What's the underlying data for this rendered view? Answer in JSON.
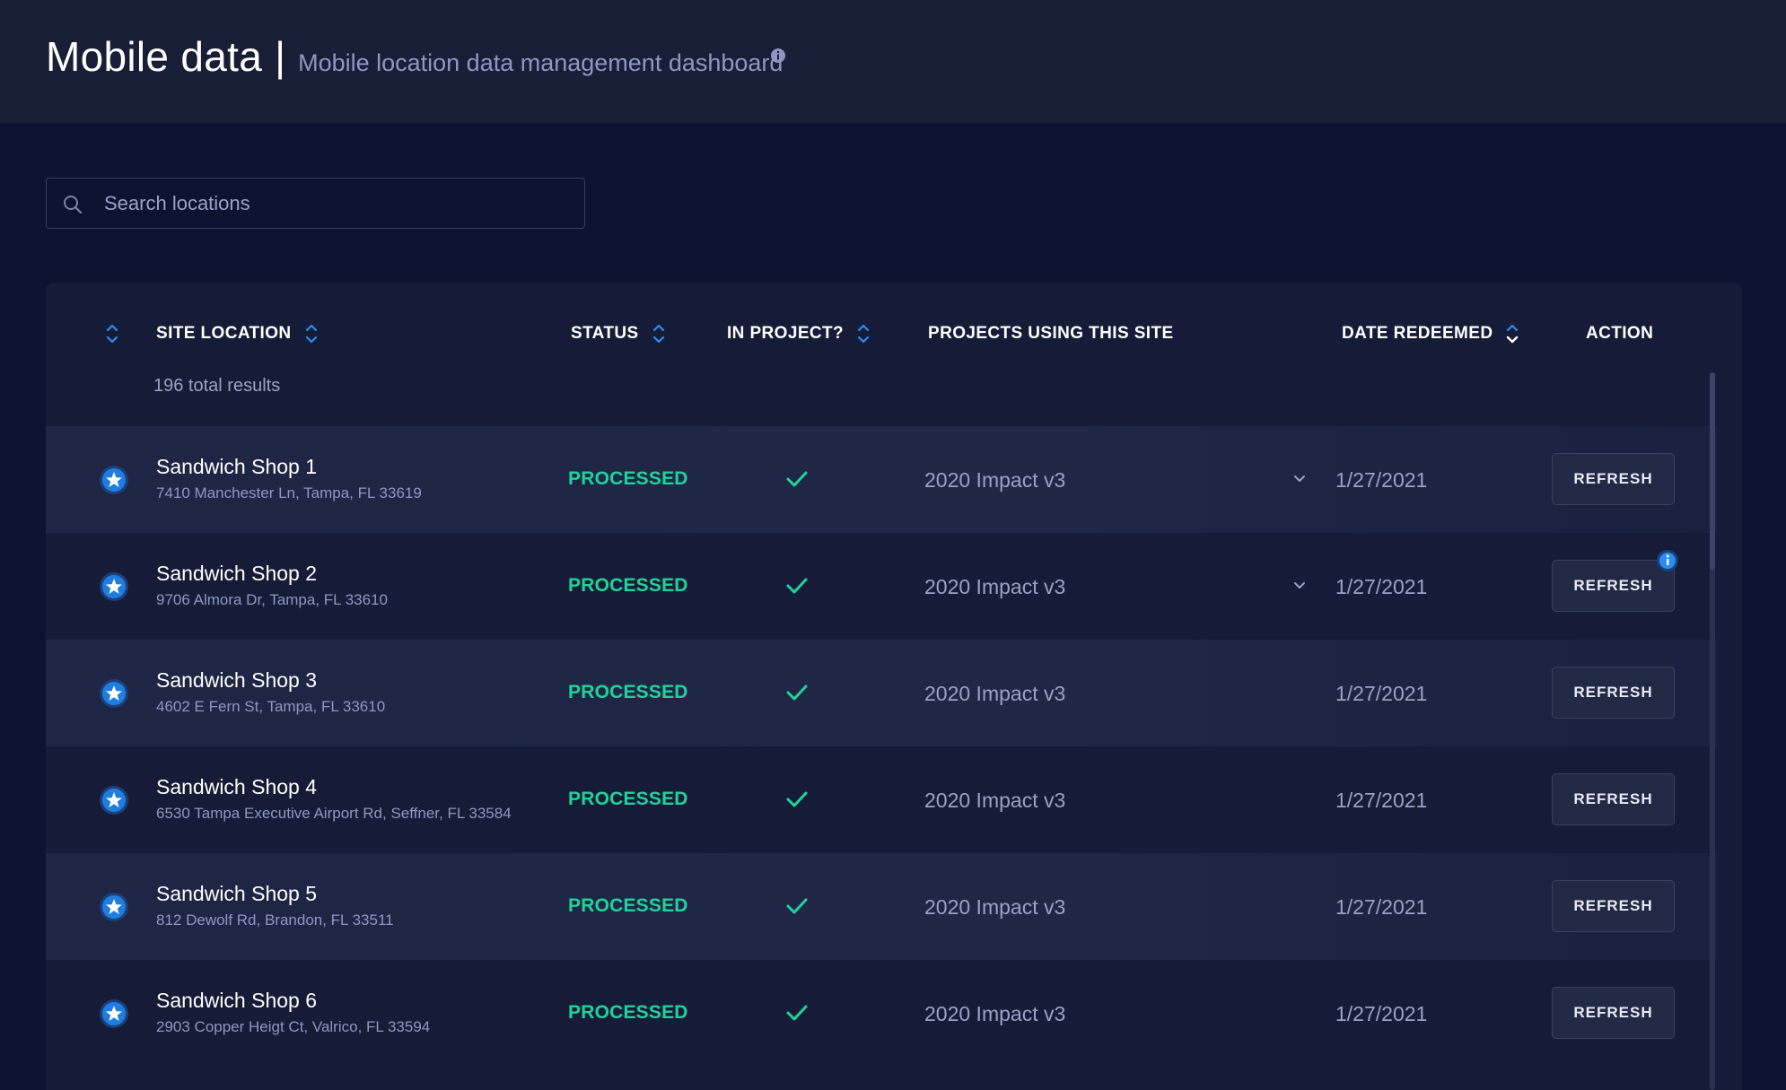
{
  "header": {
    "title": "Mobile data",
    "separator": "|",
    "subtitle": "Mobile location data management dashboard",
    "info_icon": "info-circle-icon"
  },
  "search": {
    "placeholder": "Search locations",
    "value": "",
    "icon": "search-icon"
  },
  "table": {
    "columns": [
      {
        "key": "favorite",
        "label": "",
        "sortable": true
      },
      {
        "key": "site_location",
        "label": "SITE LOCATION",
        "sortable": true
      },
      {
        "key": "status",
        "label": "STATUS",
        "sortable": true
      },
      {
        "key": "in_project",
        "label": "IN PROJECT?",
        "sortable": true
      },
      {
        "key": "projects",
        "label": "PROJECTS USING THIS SITE",
        "sortable": false
      },
      {
        "key": "date_redeemed",
        "label": "DATE REDEEMED",
        "sortable": true,
        "sort_active": "descending"
      },
      {
        "key": "action",
        "label": "ACTION",
        "sortable": false
      }
    ],
    "total_results": "196 total results",
    "rows": [
      {
        "name": "Sandwich Shop 1",
        "address": "7410 Manchester Ln, Tampa, FL 33619",
        "status": "PROCESSED",
        "in_project": true,
        "project": "2020 Impact v3",
        "has_dropdown": true,
        "date": "1/27/2021",
        "action": "REFRESH",
        "info_badge": false
      },
      {
        "name": "Sandwich Shop 2",
        "address": "9706 Almora Dr, Tampa, FL 33610",
        "status": "PROCESSED",
        "in_project": true,
        "project": "2020 Impact v3",
        "has_dropdown": true,
        "date": "1/27/2021",
        "action": "REFRESH",
        "info_badge": true
      },
      {
        "name": "Sandwich Shop 3",
        "address": "4602 E Fern St, Tampa, FL 33610",
        "status": "PROCESSED",
        "in_project": true,
        "project": "2020 Impact v3",
        "has_dropdown": false,
        "date": "1/27/2021",
        "action": "REFRESH",
        "info_badge": false
      },
      {
        "name": "Sandwich Shop 4",
        "address": "6530 Tampa Executive Airport Rd, Seffner, FL 33584",
        "status": "PROCESSED",
        "in_project": true,
        "project": "2020 Impact v3",
        "has_dropdown": false,
        "date": "1/27/2021",
        "action": "REFRESH",
        "info_badge": false
      },
      {
        "name": "Sandwich Shop 5",
        "address": "812 Dewolf Rd, Brandon, FL 33511",
        "status": "PROCESSED",
        "in_project": true,
        "project": "2020 Impact v3",
        "has_dropdown": false,
        "date": "1/27/2021",
        "action": "REFRESH",
        "info_badge": false
      },
      {
        "name": "Sandwich Shop 6",
        "address": "2903 Copper Heigt Ct, Valrico, FL 33594",
        "status": "PROCESSED",
        "in_project": true,
        "project": "2020 Impact v3",
        "has_dropdown": false,
        "date": "1/27/2021",
        "action": "REFRESH",
        "info_badge": false
      }
    ]
  },
  "colors": {
    "background": "#0c1330",
    "header_bg": "#181e36",
    "card_bg": "#161c37",
    "accent_blue": "#1f7de0",
    "status_green": "#1ed39a",
    "muted_text": "#9aa1c6"
  },
  "icons": {
    "sort": "sort-arrows-icon",
    "favorite": "star-badge-icon",
    "check": "check-icon",
    "dropdown": "chevron-down-icon",
    "info": "info-circle-icon"
  }
}
